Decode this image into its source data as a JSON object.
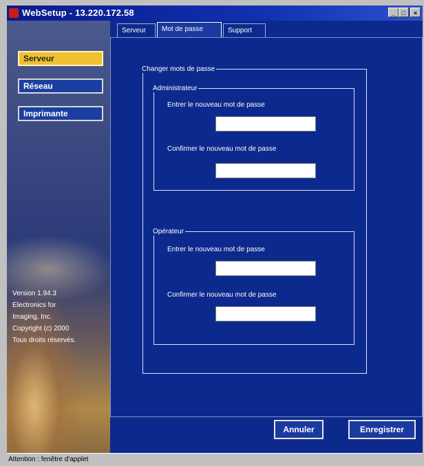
{
  "window": {
    "title": "WebSetup - 13.220.172.58",
    "controls": [
      "minimize-icon",
      "maximize-icon",
      "close-icon"
    ]
  },
  "sidebar": {
    "items": [
      {
        "label": "Serveur",
        "active": true
      },
      {
        "label": "Réseau",
        "active": false
      },
      {
        "label": "Imprimante",
        "active": false
      }
    ],
    "info_lines": [
      "Version 1.94.3",
      "Electronics for",
      "Imaging, Inc.",
      "Copyright (c) 2000",
      "Tous droits réservés."
    ]
  },
  "tabs": [
    {
      "label": "Serveur",
      "active": false
    },
    {
      "label": "Mot de passe",
      "active": true
    },
    {
      "label": "Support",
      "active": false
    }
  ],
  "form": {
    "group_title": "Changer mots de passe",
    "admin": {
      "legend": "Administrateur",
      "new_label": "Entrer le nouveau mot de passe",
      "new_value": "",
      "confirm_label": "Confirmer le nouveau mot de passe",
      "confirm_value": ""
    },
    "operator": {
      "legend": "Opérateur",
      "new_label": "Entrer le nouveau mot de passe",
      "new_value": "",
      "confirm_label": "Confirmer le nouveau mot de passe",
      "confirm_value": ""
    }
  },
  "actions": {
    "cancel_label": "Annuler",
    "save_label": "Enregistrer"
  },
  "status": {
    "text": "Attention : fenêtre d'applet"
  },
  "colors": {
    "background": "#0c2a8e",
    "active_nav": "#f0c030",
    "title_bar": "#0a1a8c"
  }
}
